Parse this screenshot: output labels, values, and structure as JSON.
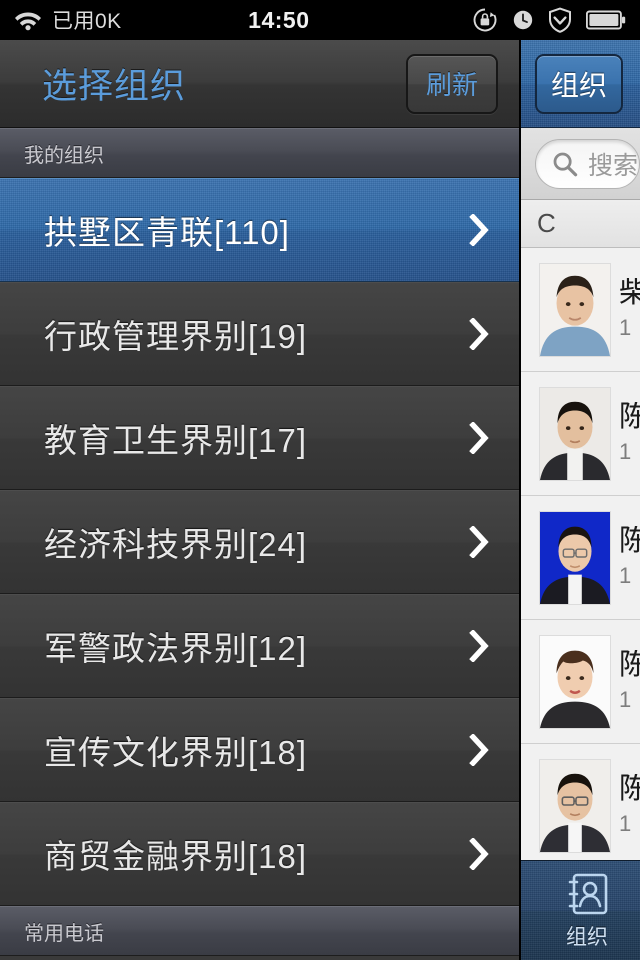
{
  "status_bar": {
    "wifi_icon": "wifi-icon",
    "data_usage": "已用0K",
    "time": "14:50",
    "rotation_lock_icon": "rotation-lock-icon",
    "alarm_icon": "alarm-clock-icon",
    "shield_icon": "shield-icon",
    "battery_icon": "battery-icon"
  },
  "left_pane": {
    "nav": {
      "title": "选择组织",
      "refresh_label": "刷新"
    },
    "sections": [
      {
        "header": "我的组织"
      },
      {
        "header": "常用电话"
      }
    ],
    "org_items": [
      {
        "label": "拱墅区青联[110]",
        "selected": true
      },
      {
        "label": "行政管理界别[19]",
        "selected": false
      },
      {
        "label": "教育卫生界别[17]",
        "selected": false
      },
      {
        "label": "经济科技界别[24]",
        "selected": false
      },
      {
        "label": "军警政法界别[12]",
        "selected": false
      },
      {
        "label": "宣传文化界别[18]",
        "selected": false
      },
      {
        "label": "商贸金融界别[18]",
        "selected": false
      }
    ],
    "chevron_icon": "chevron-right-icon"
  },
  "right_pane": {
    "nav": {
      "org_button_label": "组织"
    },
    "search": {
      "placeholder": "搜索",
      "value": "",
      "icon": "search-icon"
    },
    "index_header": "C",
    "contacts": [
      {
        "name": "柴",
        "phone": "1",
        "avatar": "photo-male-blue-shirt"
      },
      {
        "name": "陈",
        "phone": "1",
        "avatar": "photo-male-dark-jacket"
      },
      {
        "name": "陈",
        "phone": "1",
        "avatar": "photo-female-glasses-blue-bg"
      },
      {
        "name": "陈",
        "phone": "1",
        "avatar": "photo-female-short-hair"
      },
      {
        "name": "陈",
        "phone": "1",
        "avatar": "photo-male-glasses"
      }
    ],
    "tabbar": [
      {
        "label": "组织",
        "icon": "contacts-book-icon",
        "active": true
      }
    ]
  },
  "colors": {
    "accent_blue": "#5b9cdb",
    "selected_row": "#2f6aa8",
    "nav_blue": "#2f68a6",
    "left_bg": "#3a3a3a",
    "right_bg": "#ececec"
  }
}
